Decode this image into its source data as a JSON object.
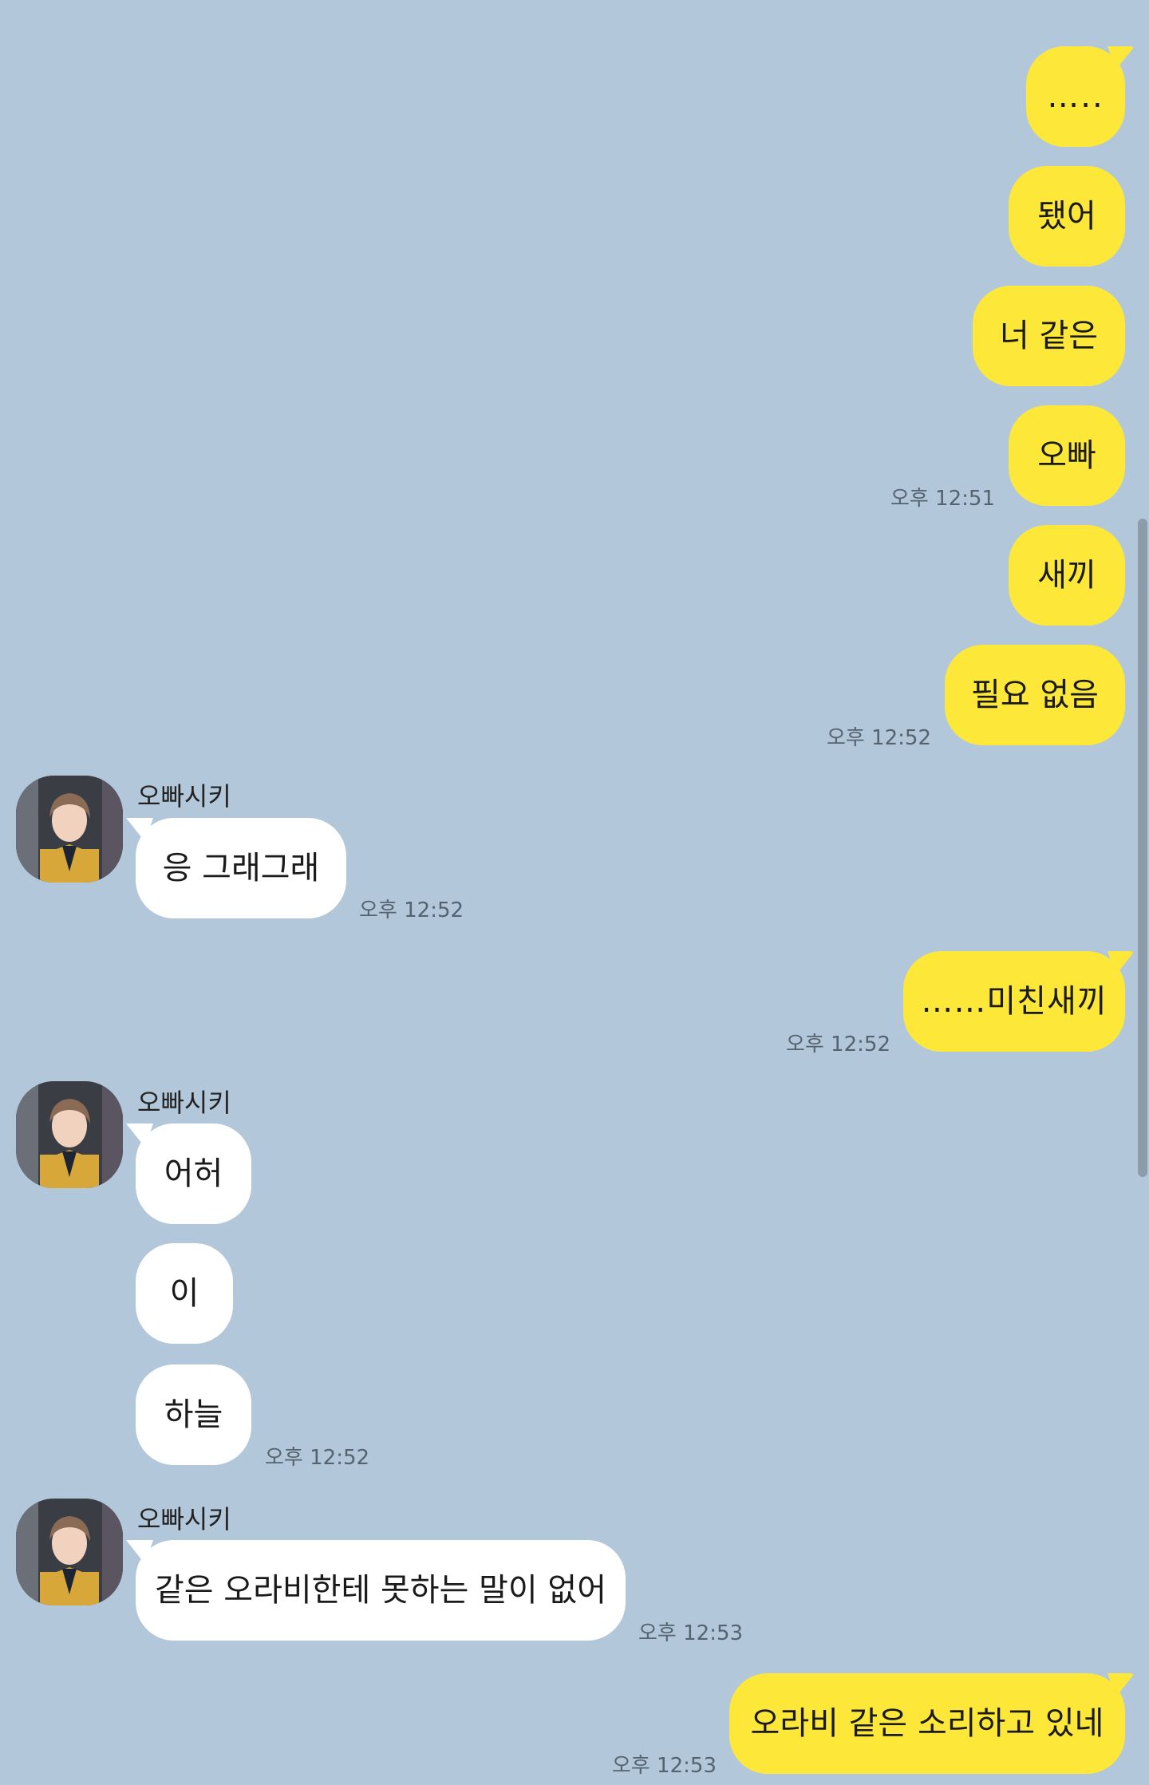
{
  "messages": {
    "m1": "…..",
    "m2": "됐어",
    "m3": "너 같은",
    "m4": "오빠",
    "m5": "새끼",
    "m6": "필요 없음",
    "m7": "응 그래그래",
    "m8": "……미친새끼",
    "m9": "어허",
    "m10": "이",
    "m11": "하늘",
    "m12": "같은 오라비한테 못하는 말이 없어",
    "m13": "오라비 같은 소리하고 있네"
  },
  "times": {
    "t1": "오후 12:51",
    "t2": "오후 12:52",
    "t3": "오후 12:52",
    "t4": "오후 12:52",
    "t5": "오후 12:52",
    "t6": "오후 12:53",
    "t7": "오후 12:53"
  },
  "sender": {
    "name": "오빠시키"
  },
  "colors": {
    "background": "#b2c7da",
    "my_bubble": "#fde83a",
    "their_bubble": "#ffffff"
  }
}
